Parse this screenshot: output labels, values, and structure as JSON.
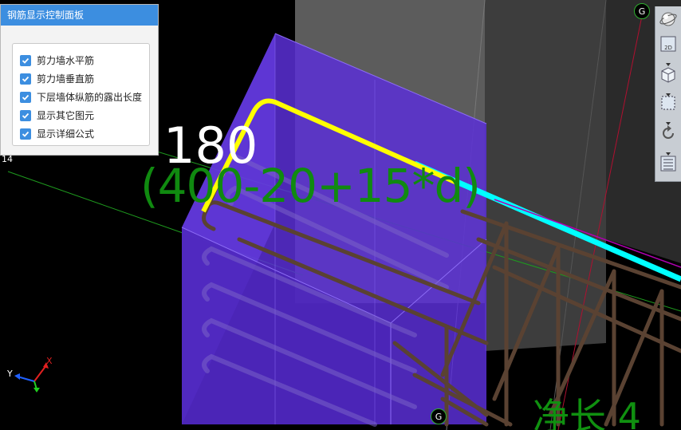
{
  "panel": {
    "title": "钢筋显示控制面板",
    "options": [
      {
        "label": "剪力墙水平筋",
        "checked": true
      },
      {
        "label": "剪力墙垂直筋",
        "checked": true
      },
      {
        "label": "下层墙体纵筋的露出长度",
        "checked": true
      },
      {
        "label": "显示其它图元",
        "checked": true
      },
      {
        "label": "显示详细公式",
        "checked": true
      }
    ]
  },
  "annotation": {
    "length": "180",
    "formula": "(400-20+15*d)",
    "bottom_text": "净长  4"
  },
  "axes": {
    "grid_label_top": "G",
    "grid_label_bottom": "G",
    "grid_number_left": "14",
    "triad_y": "Y",
    "triad_x": "X"
  },
  "toolbar": {
    "icons": [
      "orbit-icon",
      "2d-view-icon",
      "3d-box-icon",
      "select-box-icon",
      "rotate-icon",
      "layer-list-icon"
    ],
    "view_2d_label": "2D"
  },
  "colors": {
    "wall_fill": "#5a2fd6",
    "rebar_highlight": "#ffff00",
    "rebar_selected": "#00ffff",
    "rebar": "#5a4232",
    "formula_text": "#108a10",
    "panel_header": "#3c8ee0"
  }
}
